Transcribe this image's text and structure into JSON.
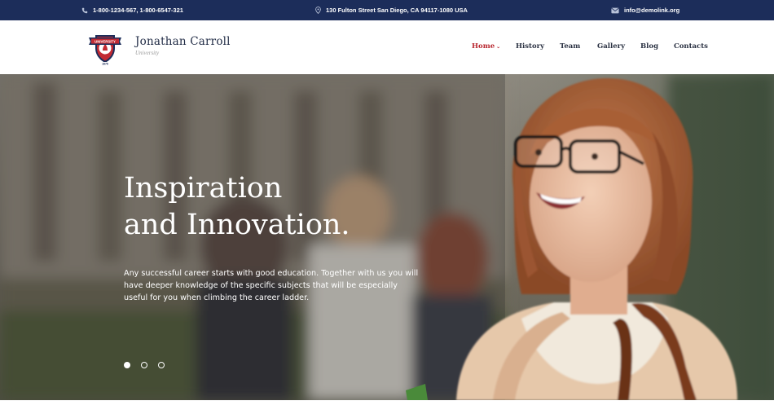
{
  "topbar": {
    "phones": "1-800-1234-567, 1-800-6547-321",
    "address": "130 Fulton Street San Diego, CA 94117-1080 USA",
    "email": "info@demolink.org"
  },
  "brand": {
    "name": "Jonathan Carroll",
    "subtitle": "University",
    "logo_text": "UNIVERSITY",
    "logo_year": "1876"
  },
  "nav": {
    "items": [
      {
        "label": "Home",
        "active": true,
        "has_dropdown": true
      },
      {
        "label": "History",
        "active": false
      },
      {
        "label": "Team",
        "active": false
      },
      {
        "label": "Gallery",
        "active": false
      },
      {
        "label": "Blog",
        "active": false
      },
      {
        "label": "Contacts",
        "active": false
      }
    ]
  },
  "hero": {
    "title_line1": "Inspiration",
    "title_line2": "and Innovation.",
    "text": "Any successful career starts with good education. Together with us you will have deeper knowledge of the specific subjects that will be especially useful for you when climbing the career ladder.",
    "slides": 3,
    "active_slide": 1
  },
  "colors": {
    "topbar": "#1c2d5a",
    "accent": "#b8262e",
    "nav_text": "#2a3142"
  },
  "icons": {
    "phone": "phone-icon",
    "address": "map-pin-icon",
    "email": "envelope-icon",
    "dropdown": "chevron-down-icon"
  }
}
